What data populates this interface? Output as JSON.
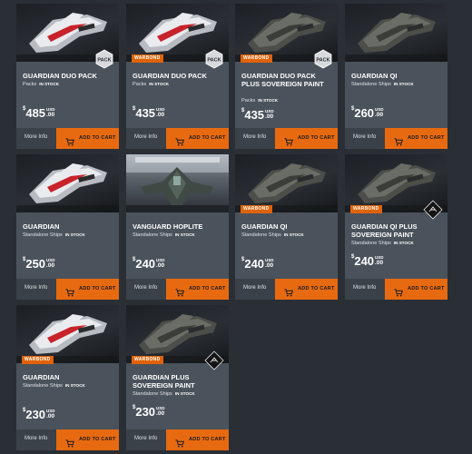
{
  "products": [
    {
      "title": "GUARDIAN DUO PACK",
      "category": "Packs",
      "stock": "IN STOCK",
      "currency_symbol": "$",
      "price": "485",
      "currency": "USD",
      "cents": ".00",
      "more_info": "More Info",
      "cart_label": "ADD TO CART",
      "badge": "PACK",
      "warbond": "",
      "ship": "red"
    },
    {
      "title": "GUARDIAN DUO PACK",
      "category": "Packs",
      "stock": "IN STOCK",
      "currency_symbol": "$",
      "price": "435",
      "currency": "USD",
      "cents": ".00",
      "more_info": "More Info",
      "cart_label": "ADD TO CART",
      "badge": "PACK",
      "warbond": "WARBOND",
      "ship": "red"
    },
    {
      "title": "GUARDIAN DUO PACK PLUS SOVEREIGN PAINT",
      "category": "Packs",
      "stock": "IN STOCK",
      "currency_symbol": "$",
      "price": "435",
      "currency": "USD",
      "cents": ".00",
      "more_info": "More Info",
      "cart_label": "ADD TO CART",
      "badge": "PACK",
      "warbond": "WARBOND",
      "ship": "dark"
    },
    {
      "title": "GUARDIAN QI",
      "category": "Standalone Ships",
      "stock": "IN STOCK",
      "currency_symbol": "$",
      "price": "260",
      "currency": "USD",
      "cents": ".00",
      "more_info": "More Info",
      "cart_label": "ADD TO CART",
      "badge": "",
      "warbond": "",
      "ship": "dark"
    },
    {
      "title": "GUARDIAN",
      "category": "Standalone Ships",
      "stock": "IN STOCK",
      "currency_symbol": "$",
      "price": "250",
      "currency": "USD",
      "cents": ".00",
      "more_info": "More Info",
      "cart_label": "ADD TO CART",
      "badge": "",
      "warbond": "",
      "ship": "red"
    },
    {
      "title": "VANGUARD HOPLITE",
      "category": "Standalone Ships",
      "stock": "IN STOCK",
      "currency_symbol": "$",
      "price": "240",
      "currency": "USD",
      "cents": ".00",
      "more_info": "More Info",
      "cart_label": "ADD TO CART",
      "badge": "",
      "warbond": "",
      "ship": "hangar"
    },
    {
      "title": "GUARDIAN QI",
      "category": "Standalone Ships",
      "stock": "IN STOCK",
      "currency_symbol": "$",
      "price": "240",
      "currency": "USD",
      "cents": ".00",
      "more_info": "More Info",
      "cart_label": "ADD TO CART",
      "badge": "",
      "warbond": "WARBOND",
      "ship": "dark"
    },
    {
      "title": "GUARDIAN QI PLUS SOVEREIGN PAINT",
      "category": "Standalone Ships",
      "stock": "IN STOCK",
      "currency_symbol": "$",
      "price": "240",
      "currency": "USD",
      "cents": ".00",
      "more_info": "More Info",
      "cart_label": "ADD TO CART",
      "badge": "PAINT",
      "warbond": "WARBOND",
      "ship": "dark"
    },
    {
      "title": "GUARDIAN",
      "category": "Standalone Ships",
      "stock": "IN STOCK",
      "currency_symbol": "$",
      "price": "230",
      "currency": "USD",
      "cents": ".00",
      "more_info": "More Info",
      "cart_label": "ADD TO CART",
      "badge": "",
      "warbond": "WARBOND",
      "ship": "red"
    },
    {
      "title": "GUARDIAN PLUS SOVEREIGN PAINT",
      "category": "Standalone Ships",
      "stock": "IN STOCK",
      "currency_symbol": "$",
      "price": "230",
      "currency": "USD",
      "cents": ".00",
      "more_info": "More Info",
      "cart_label": "ADD TO CART",
      "badge": "PAINT",
      "warbond": "WARBOND",
      "ship": "dark"
    }
  ],
  "colors": {
    "accent": "#e86a10",
    "card_bg": "#4a535c",
    "footer_bg": "#3a4148",
    "page_bg": "#2a2e35"
  }
}
